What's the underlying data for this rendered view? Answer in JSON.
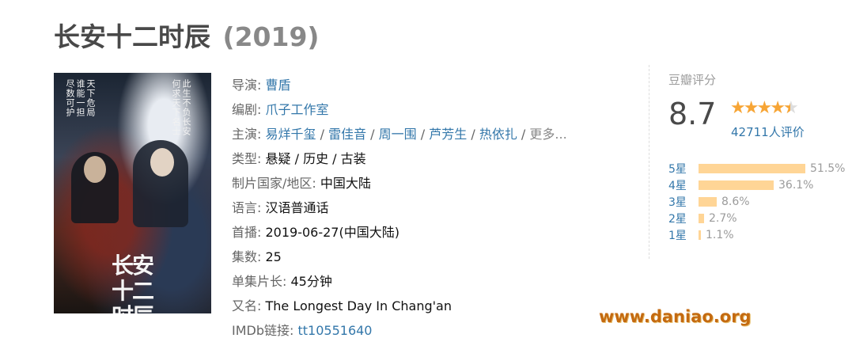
{
  "title": {
    "name": "长安十二时辰",
    "year": "(2019)"
  },
  "info": {
    "director": {
      "label": "导演",
      "value": "曹盾"
    },
    "writer": {
      "label": "编剧",
      "value": "爪子工作室"
    },
    "cast": {
      "label": "主演",
      "names": [
        "易烊千玺",
        "雷佳音",
        "周一围",
        "芦芳生",
        "热依扎"
      ],
      "more": "更多..."
    },
    "genre": {
      "label": "类型",
      "values": [
        "悬疑",
        "历史",
        "古装"
      ]
    },
    "country": {
      "label": "制片国家/地区",
      "value": "中国大陆"
    },
    "language": {
      "label": "语言",
      "value": "汉语普通话"
    },
    "premiere": {
      "label": "首播",
      "value": "2019-06-27(中国大陆)"
    },
    "episodes": {
      "label": "集数",
      "value": "25"
    },
    "runtime": {
      "label": "单集片长",
      "value": "45分钟"
    },
    "aka": {
      "label": "又名",
      "value": "The Longest Day In Chang'an"
    },
    "imdb": {
      "label": "IMDb链接",
      "value": "tt10551640"
    }
  },
  "rating": {
    "label": "豆瓣评分",
    "score": "8.7",
    "stars": 4.5,
    "count": "42711人评价",
    "distribution": [
      {
        "star": "5星",
        "percent": "51.5%",
        "value": 51.5
      },
      {
        "star": "4星",
        "percent": "36.1%",
        "value": 36.1
      },
      {
        "star": "3星",
        "percent": "8.6%",
        "value": 8.6
      },
      {
        "star": "2星",
        "percent": "2.7%",
        "value": 2.7
      },
      {
        "star": "1星",
        "percent": "1.1%",
        "value": 1.1
      }
    ]
  },
  "poster": {
    "left_text": [
      "天下危局",
      "谁能一担",
      "尽数可护"
    ],
    "right_text": [
      "此生不负长安",
      "何求天下名士"
    ],
    "logo": "长安十二时辰"
  },
  "watermark": "www.daniao.org",
  "colors": {
    "link": "#3377aa",
    "bar": "#ffd596",
    "star": "#f7a535",
    "watermark": "#c46a10"
  }
}
